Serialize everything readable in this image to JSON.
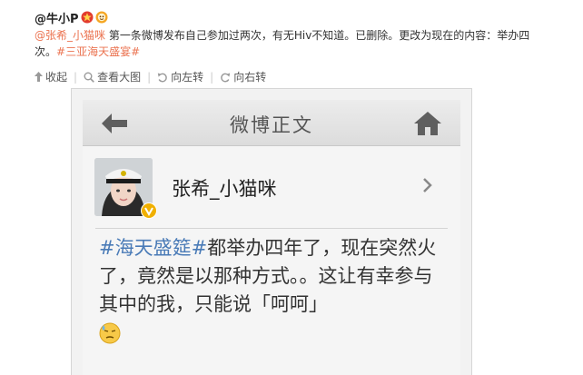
{
  "post": {
    "author": "@牛小P",
    "badges": [
      "star-badge-icon",
      "crown-badge-icon"
    ],
    "mention": "@张希_小猫咪",
    "text_after_mention": " 第一条微博发布自己参加过两次，有无Hiv不知道。已删除。更改为现在的内容：举办四次。",
    "topic": "#三亚海天盛宴#"
  },
  "actions": {
    "collect": "收起",
    "view_large": "查看大图",
    "rotate_left": "向左转",
    "rotate_right": "向右转"
  },
  "screenshot": {
    "nav_title": "微博正文",
    "profile_name": "张希_小猫咪",
    "topic": "#海天盛筵#",
    "text": "都举办四年了，现在突然火了，竟然是以那种方式。。这让有幸参与其中的我，只能说「呵呵」",
    "emoji": "sweat-emoji-icon"
  },
  "colors": {
    "accent_orange": "#eb7350",
    "topic_blue": "#4a7bb7",
    "verified_gold": "#f0b000"
  }
}
